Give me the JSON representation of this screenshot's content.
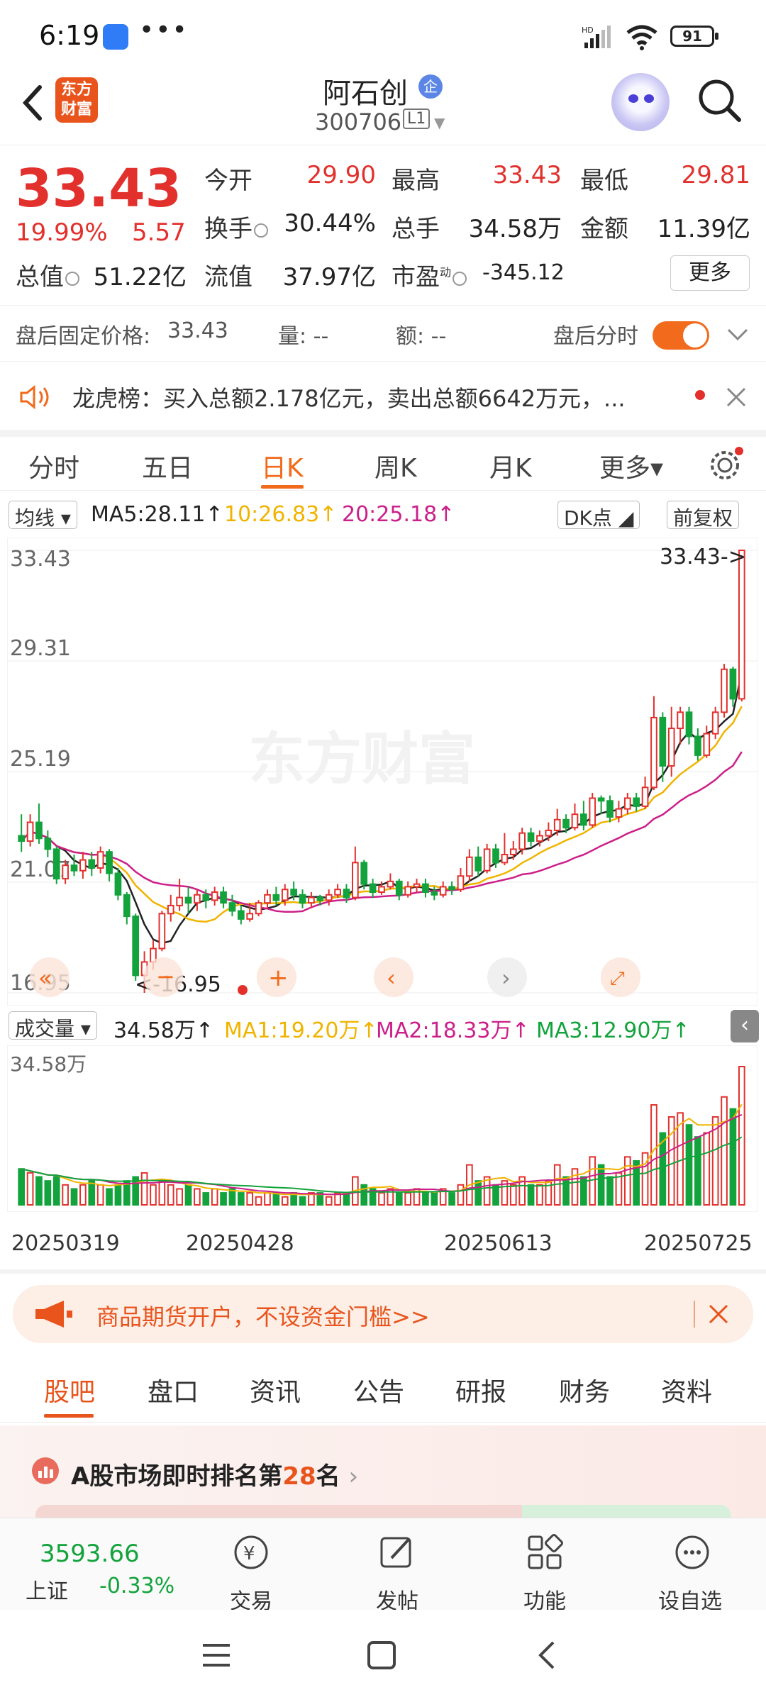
{
  "status_bar": {
    "time": "6:19",
    "battery": "91"
  },
  "header": {
    "logo_text": "东方财富",
    "stock_name": "阿石创",
    "enterprise_badge": "企",
    "stock_code": "300706",
    "level": "L1"
  },
  "quote": {
    "price": "33.43",
    "change_pct": "19.99%",
    "change": "5.57",
    "open_label": "今开",
    "open": "29.90",
    "high_label": "最高",
    "high": "33.43",
    "low_label": "最低",
    "low": "29.81",
    "turnover_label": "换手",
    "turnover": "30.44%",
    "volume_label": "总手",
    "volume": "34.58万",
    "amount_label": "金额",
    "amount": "11.39亿",
    "mktcap_label": "总值",
    "mktcap": "51.22亿",
    "float_label": "流值",
    "float": "37.97亿",
    "pe_label": "市盈",
    "pe_sup": "动",
    "pe": "-345.12",
    "more_label": "更多"
  },
  "after_hours": {
    "fixed_price_label": "盘后固定价格:",
    "fixed_price": "33.43",
    "vol_label": "量: --",
    "amt_label": "额: --",
    "intraday_label": "盘后分时"
  },
  "notice": {
    "text": "龙虎榜：买入总额2.178亿元，卖出总额6642万元，..."
  },
  "chart_tabs": [
    "分时",
    "五日",
    "日K",
    "周K",
    "月K",
    "更多▾"
  ],
  "ma_line": {
    "selector": "均线",
    "ma5": "MA5:28.11↑",
    "ma10": "10:26.83↑",
    "ma20": "20:25.18↑",
    "dk": "DK点",
    "adjust": "前复权"
  },
  "price_axis": [
    "33.43",
    "29.31",
    "25.19",
    "21.07",
    "16.95"
  ],
  "last_price_tag": "33.43->",
  "low_tag": "<-16.95",
  "watermark": "东方财富",
  "vol_line": {
    "selector": "成交量",
    "value": "34.58万↑",
    "ma1": "MA1:19.20万↑",
    "ma2": "MA2:18.33万↑",
    "ma3": "MA3:12.90万↑"
  },
  "vol_axis_top": "34.58万",
  "date_axis": [
    "20250319",
    "20250428",
    "20250613",
    "20250725"
  ],
  "ad": {
    "text": "商品期货开户，不设资金门槛>>"
  },
  "sub_tabs": [
    "股吧",
    "盘口",
    "资讯",
    "公告",
    "研报",
    "财务",
    "资料"
  ],
  "rank": {
    "prefix": "A股市场即时排名第",
    "rank": "28",
    "suffix": "名"
  },
  "bottom_nav": {
    "index_value": "3593.66",
    "index_name": "上证",
    "index_change": "-0.33%",
    "items": [
      "交易",
      "发帖",
      "功能",
      "设自选"
    ]
  },
  "colors": {
    "up": "#e2312d",
    "down": "#12a33c",
    "accent": "#f26a1b",
    "ma5": "#222222",
    "ma10": "#f0b400",
    "ma20": "#cc1f8a"
  },
  "chart_data": {
    "type": "candlestick",
    "yrange": [
      16.95,
      33.43
    ],
    "note": "daily K-line, 2025-03-19 to 2025-07-25 (estimated)",
    "candles": [
      [
        22.8,
        22.6,
        23.6,
        22.2
      ],
      [
        22.6,
        23.3,
        23.6,
        22.4
      ],
      [
        23.3,
        22.7,
        24.0,
        22.5
      ],
      [
        22.7,
        22.3,
        23.0,
        22.0
      ],
      [
        22.3,
        21.2,
        22.4,
        21.0
      ],
      [
        21.2,
        21.7,
        21.9,
        21.0
      ],
      [
        21.7,
        21.5,
        22.1,
        21.3
      ],
      [
        21.5,
        21.9,
        22.2,
        21.2
      ],
      [
        21.9,
        21.6,
        22.2,
        21.3
      ],
      [
        21.6,
        22.2,
        22.4,
        21.4
      ],
      [
        22.2,
        21.4,
        22.3,
        21.1
      ],
      [
        21.4,
        20.6,
        21.6,
        20.4
      ],
      [
        20.6,
        19.8,
        20.7,
        19.5
      ],
      [
        19.8,
        17.6,
        19.9,
        17.4
      ],
      [
        17.6,
        18.1,
        18.5,
        16.95
      ],
      [
        18.1,
        18.6,
        18.9,
        17.8
      ],
      [
        18.6,
        19.9,
        20.0,
        18.5
      ],
      [
        19.9,
        20.2,
        20.6,
        19.6
      ],
      [
        20.2,
        20.5,
        21.2,
        20.0
      ],
      [
        20.5,
        20.3,
        20.9,
        19.9
      ],
      [
        20.3,
        20.6,
        20.8,
        20.0
      ],
      [
        20.6,
        20.4,
        20.8,
        20.1
      ],
      [
        20.4,
        20.7,
        20.9,
        20.2
      ],
      [
        20.7,
        20.3,
        20.9,
        20.1
      ],
      [
        20.3,
        20.0,
        20.6,
        19.8
      ],
      [
        20.0,
        19.7,
        20.2,
        19.5
      ],
      [
        19.7,
        19.9,
        20.3,
        19.6
      ],
      [
        19.9,
        20.3,
        20.4,
        19.8
      ],
      [
        20.3,
        20.6,
        20.8,
        20.1
      ],
      [
        20.6,
        20.4,
        20.9,
        20.2
      ],
      [
        20.4,
        20.8,
        21.0,
        20.2
      ],
      [
        20.8,
        20.6,
        21.1,
        20.4
      ],
      [
        20.6,
        20.3,
        20.8,
        20.1
      ],
      [
        20.3,
        20.5,
        20.7,
        20.1
      ],
      [
        20.5,
        20.4,
        20.6,
        20.2
      ],
      [
        20.4,
        20.6,
        20.8,
        20.2
      ],
      [
        20.6,
        20.8,
        21.0,
        20.5
      ],
      [
        20.8,
        20.5,
        21.0,
        20.3
      ],
      [
        20.5,
        21.8,
        22.4,
        20.4
      ],
      [
        21.8,
        21.0,
        21.9,
        20.8
      ],
      [
        21.0,
        20.7,
        21.2,
        20.5
      ],
      [
        20.7,
        20.9,
        21.1,
        20.6
      ],
      [
        20.9,
        21.1,
        21.4,
        20.8
      ],
      [
        21.1,
        20.6,
        21.2,
        20.4
      ],
      [
        20.6,
        20.9,
        21.1,
        20.5
      ],
      [
        20.9,
        21.0,
        21.2,
        20.7
      ],
      [
        21.0,
        20.7,
        21.2,
        20.5
      ],
      [
        20.7,
        20.6,
        20.9,
        20.4
      ],
      [
        20.6,
        20.9,
        21.1,
        20.5
      ],
      [
        20.9,
        20.8,
        21.1,
        20.6
      ],
      [
        20.8,
        21.3,
        21.6,
        20.7
      ],
      [
        21.3,
        22.0,
        22.3,
        21.1
      ],
      [
        22.0,
        21.5,
        22.4,
        21.3
      ],
      [
        21.5,
        22.3,
        22.5,
        21.4
      ],
      [
        22.3,
        21.8,
        22.5,
        21.6
      ],
      [
        21.8,
        22.1,
        22.9,
        21.7
      ],
      [
        22.1,
        22.3,
        22.6,
        21.9
      ],
      [
        22.3,
        22.9,
        23.1,
        22.1
      ],
      [
        22.9,
        22.6,
        23.1,
        22.4
      ],
      [
        22.6,
        22.8,
        23.0,
        22.4
      ],
      [
        22.8,
        23.0,
        23.3,
        22.6
      ],
      [
        23.0,
        23.4,
        23.8,
        22.8
      ],
      [
        23.4,
        23.1,
        23.6,
        22.9
      ],
      [
        23.1,
        23.6,
        24.0,
        23.0
      ],
      [
        23.6,
        23.2,
        24.1,
        23.0
      ],
      [
        23.2,
        24.2,
        24.4,
        23.1
      ],
      [
        24.2,
        24.1,
        24.3,
        23.6
      ],
      [
        24.1,
        23.5,
        24.3,
        23.3
      ],
      [
        23.5,
        23.8,
        24.1,
        23.3
      ],
      [
        23.8,
        24.2,
        24.4,
        23.6
      ],
      [
        24.2,
        23.9,
        24.4,
        23.7
      ],
      [
        23.9,
        24.6,
        25.0,
        23.8
      ],
      [
        24.6,
        27.2,
        28.0,
        24.5
      ],
      [
        27.2,
        25.4,
        27.4,
        24.8
      ],
      [
        25.4,
        26.8,
        27.6,
        25.0
      ],
      [
        26.8,
        27.4,
        27.6,
        26.2
      ],
      [
        27.4,
        26.5,
        27.6,
        26.2
      ],
      [
        26.5,
        25.8,
        26.8,
        25.6
      ],
      [
        25.8,
        26.6,
        26.9,
        25.7
      ],
      [
        26.6,
        27.4,
        27.6,
        26.4
      ],
      [
        27.4,
        29.0,
        29.2,
        27.2
      ],
      [
        29.0,
        27.9,
        29.1,
        27.6
      ],
      [
        27.9,
        33.43,
        33.43,
        27.8
      ]
    ],
    "volumes": [
      9,
      8,
      7,
      6,
      7,
      5,
      4,
      5,
      6,
      5,
      4,
      5,
      6,
      7,
      8,
      5,
      6,
      5,
      4,
      5,
      4,
      3,
      4,
      3,
      4,
      3,
      3,
      2,
      3,
      3,
      2,
      3,
      2,
      3,
      3,
      2,
      3,
      3,
      7,
      5,
      4,
      3,
      4,
      3,
      3,
      4,
      3,
      3,
      4,
      3,
      5,
      10,
      6,
      7,
      5,
      6,
      5,
      7,
      5,
      5,
      6,
      10,
      7,
      9,
      7,
      12,
      10,
      7,
      8,
      12,
      11,
      13,
      25,
      18,
      22,
      23,
      20,
      17,
      18,
      22,
      27,
      24,
      34.58
    ]
  }
}
